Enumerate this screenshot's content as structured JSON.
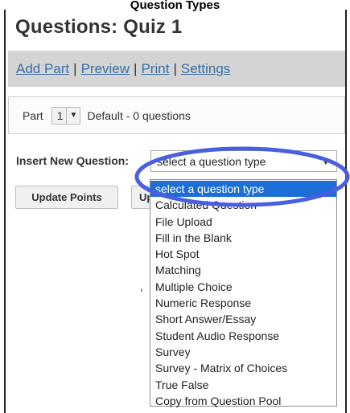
{
  "colors": {
    "link": "#3a6ea5",
    "link_bar_bg": "#d4d4d4",
    "selected_option_bg": "#1e6ed7",
    "highlight_oval": "#4a5fe0"
  },
  "page": {
    "top_title": "Question Types",
    "title": "Questions: Quiz 1"
  },
  "nav_links": [
    {
      "label": "Add Part"
    },
    {
      "label": "Preview"
    },
    {
      "label": "Print"
    },
    {
      "label": "Settings"
    }
  ],
  "nav_separator": "|",
  "part": {
    "label": "Part",
    "value": "1",
    "summary": "Default - 0 questions"
  },
  "insert": {
    "label": "Insert New Question:",
    "selected": "select a question type"
  },
  "buttons": {
    "update_points": "Update Points",
    "second": "Up"
  },
  "question_types": [
    "select a question type",
    "Calculated Question",
    "File Upload",
    "Fill in the Blank",
    "Hot Spot",
    "Matching",
    "Multiple Choice",
    "Numeric Response",
    "Short Answer/Essay",
    "Student Audio Response",
    "Survey",
    "Survey - Matrix of Choices",
    "True False",
    "Copy from Question Pool"
  ],
  "icons": {
    "dropdown_arrow": "chevron-down-icon"
  }
}
